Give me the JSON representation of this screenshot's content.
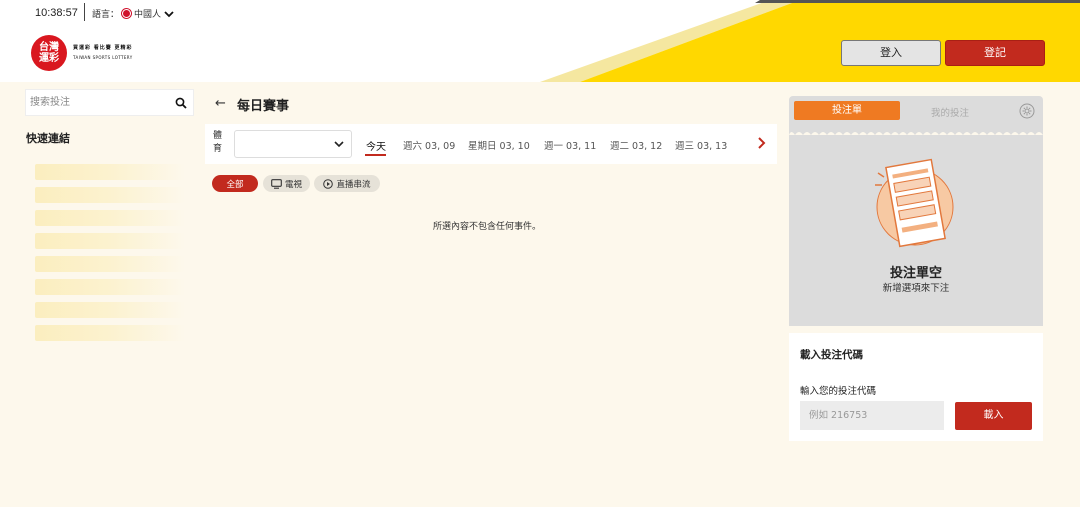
{
  "header": {
    "time": "10:38:57",
    "language_label": "語言：",
    "language_value": "中國人",
    "logo_mark": "台灣運彩",
    "logo_tagline": "買運彩 看比賽 更精彩",
    "logo_subtitle": "TAIWAN SPORTS LOTTERY",
    "login_label": "登入",
    "register_label": "登記",
    "colors": {
      "accent_yellow": "#ffd800",
      "brand_red": "#c22a1e"
    }
  },
  "sidebar": {
    "search_placeholder": "搜索投注",
    "quick_links_title": "快速連結"
  },
  "main": {
    "title": "每日賽事",
    "sport_label": "體育",
    "date_tabs": [
      "今天",
      "週六 03, 09",
      "星期日 03, 10",
      "週一 03, 11",
      "週二 03, 12",
      "週三 03, 13"
    ],
    "filters": [
      "全部",
      "電視",
      "直播串流"
    ],
    "empty_message": "所選內容不包含任何事件。"
  },
  "betslip": {
    "tab_slip": "投注單",
    "tab_mybets": "我的投注",
    "empty_title": "投注單空",
    "empty_subtitle": "新增選項來下注",
    "accent": "#ef7a22"
  },
  "bet_code": {
    "title": "載入投注代碼",
    "label": "輸入您的投注代碼",
    "placeholder": "例如 216753",
    "button": "載入"
  }
}
